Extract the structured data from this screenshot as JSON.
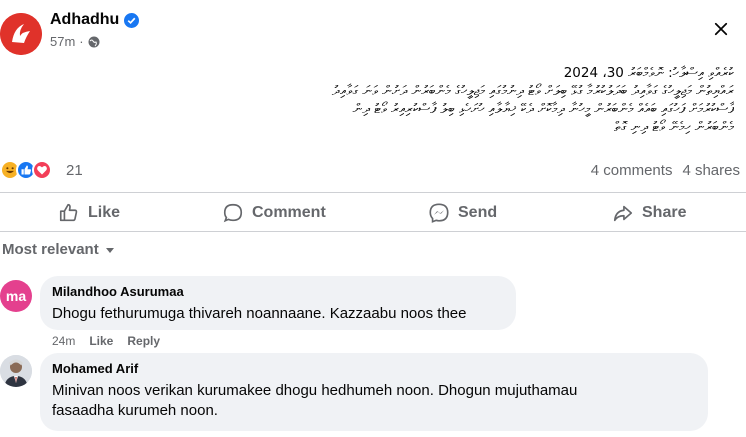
{
  "post": {
    "page_name": "Adhadhu",
    "time": "57m",
    "separator": "·",
    "text_lines": [
      "ކުރެއްވި އިސްލާހު: ނޮވެމްބަރު 30، 2024",
      "ރައްޔިތުން މަޖިލީހުގެ ގަވާއިދު ބަދަލުކުރުމާ ގުޅޭ ބިލަށް ވޯޓު ދިނުމުގައި މަޖިލީހުގެ މެންބަރުން ދަށުން ވަނަ ގަވާއިދު",
      "ފާސްކުރުމަށް ފަހުގައި ބައެއް މެންބަރުން މީހުނާ ދިމާކޮށް ދެކޭ ޚިޔާލާއި ހުށަހެޅި ބިލު ފާސްކުރިއިރު ވޯޓު ދިން",
      "މެންބަރުން ހިމެނޭ ވޯޓު ދިނި ގޮތް"
    ]
  },
  "reactions": {
    "count": "21",
    "comments": "4 comments",
    "shares": "4 shares"
  },
  "actions": {
    "like": "Like",
    "comment": "Comment",
    "send": "Send",
    "share": "Share"
  },
  "sort": {
    "label": "Most relevant"
  },
  "comments": [
    {
      "author": "Milandhoo Asurumaa",
      "avatar_text": "ma",
      "text": "Dhogu fethurumuga thivareh noannaane. Kazzaabu noos thee",
      "time": "24m",
      "like": "Like",
      "reply": "Reply"
    },
    {
      "author": "Mohamed Arif",
      "text_line1": "Minivan noos verikan kurumakee dhogu hedhumeh noon. Dhogun mujuthamau",
      "text_line2": "fasaadha kurumeh noon."
    }
  ],
  "colors": {
    "brand": "#e0322a",
    "accent": "#1877f2",
    "muted": "#65676b",
    "bubble": "#f0f2f5"
  }
}
